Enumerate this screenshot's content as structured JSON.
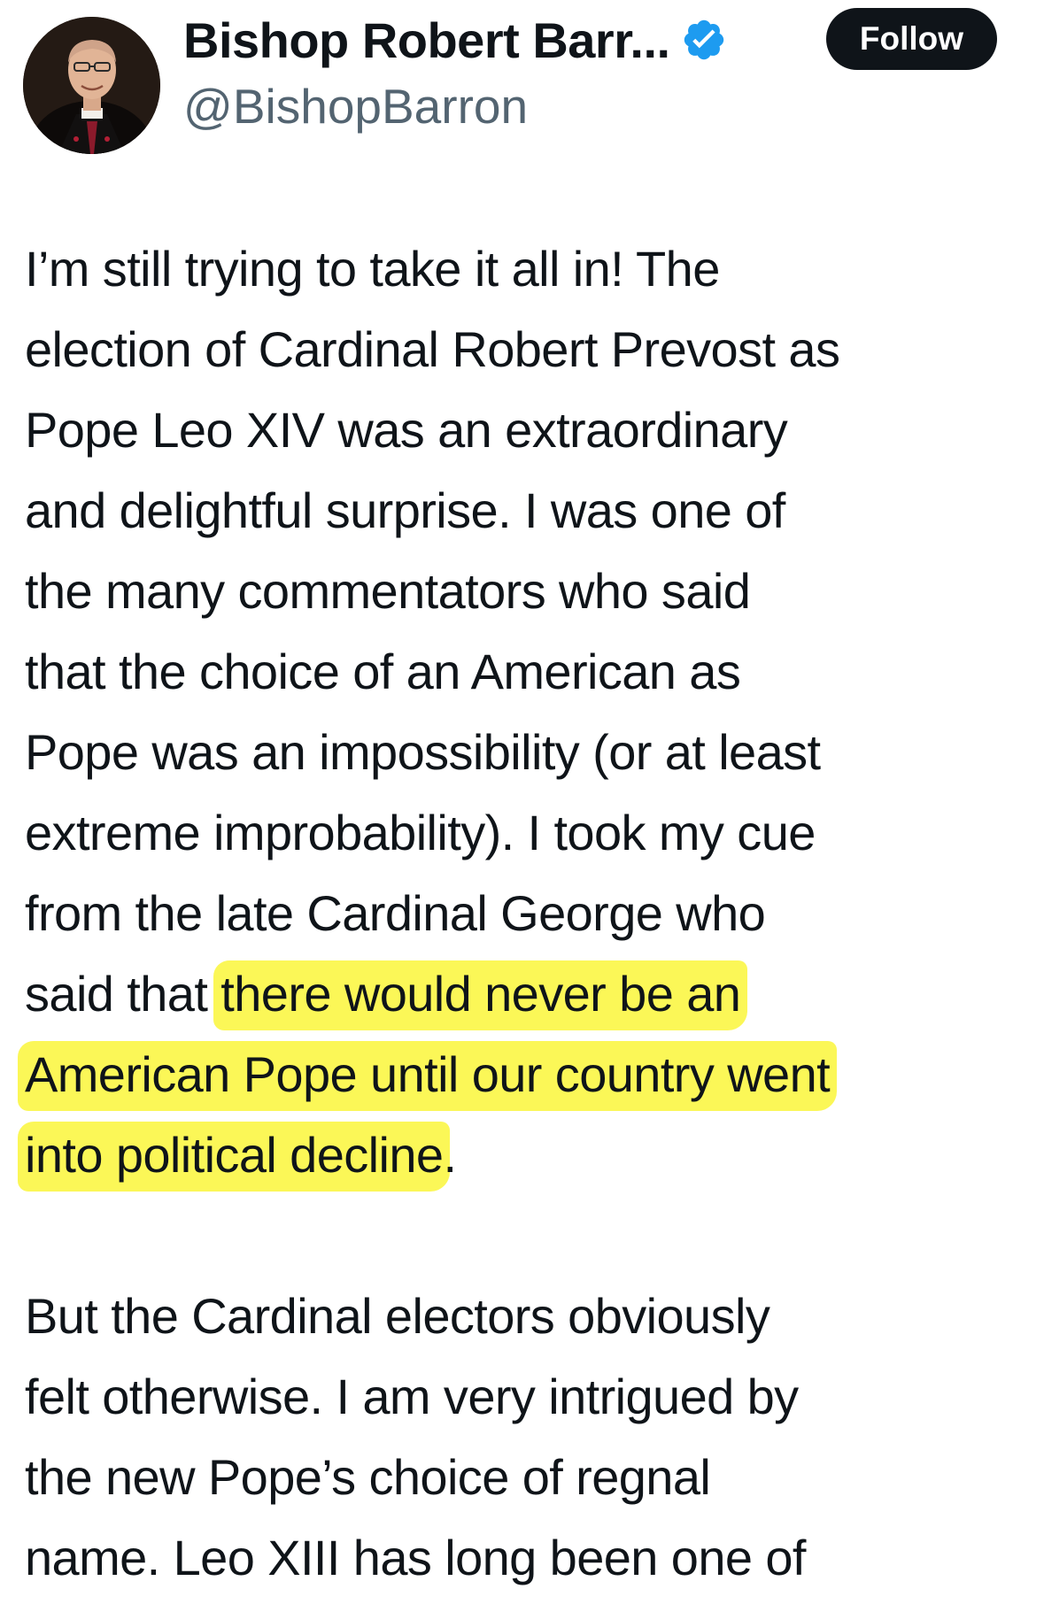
{
  "tweet": {
    "author": {
      "display_name": "Bishop Robert Barr...",
      "handle": "@BishopBarron",
      "verified_icon": "verified-badge-icon",
      "verified_color": "#1d9bf0"
    },
    "follow_label": "Follow",
    "body": {
      "lines": [
        {
          "text": "I’m still trying to take it all in!  The"
        },
        {
          "text": "election of Cardinal Robert Prevost as"
        },
        {
          "text": "Pope Leo XIV was an extraordinary"
        },
        {
          "text": "and delightful surprise.  I was one of"
        },
        {
          "text": "the many commentators who said"
        },
        {
          "text": "that the choice of an American as"
        },
        {
          "text": "Pope was an impossibility (or at least"
        },
        {
          "text": "extreme improbability).  I took my cue"
        },
        {
          "text": "from the late Cardinal George who"
        },
        {
          "pre": "said that ",
          "highlight": "there would never be an"
        },
        {
          "highlight": "American Pope until our country went"
        },
        {
          "highlight": "into political decline",
          "post": "."
        }
      ],
      "paragraph2_lines": [
        {
          "text": "But the Cardinal electors obviously"
        },
        {
          "text": "felt otherwise. I am very intrigued by"
        },
        {
          "text": "the new Pope’s choice of regnal"
        },
        {
          "text": "name.  Leo XIII has long been one of"
        }
      ]
    },
    "highlight_color": "#faf528"
  }
}
